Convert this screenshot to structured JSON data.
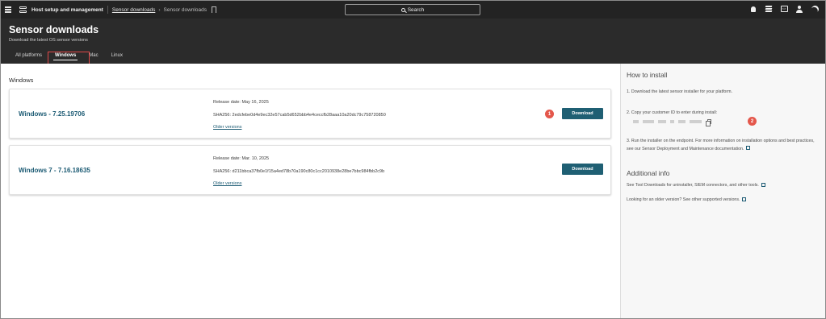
{
  "topbar": {
    "root": "Host setup and management",
    "crumb_link": "Sensor downloads",
    "crumb_current": "Sensor downloads",
    "chevron": "›",
    "search_label": "Search",
    "icons": [
      "bell-icon",
      "stack-icon",
      "keyboard-icon",
      "user-icon",
      "moon-icon"
    ]
  },
  "header": {
    "title": "Sensor downloads",
    "subtitle": "Download the latest OS sensor versions",
    "tabs": [
      "All platforms",
      "Windows",
      "Mac",
      "Linux"
    ],
    "active_tab": "Windows"
  },
  "main": {
    "section_title": "Windows",
    "sensors": [
      {
        "name": "Windows - 7.25.19706",
        "release": "Release date: May 16, 2025",
        "sha": "SHA256: 2edcfebe0d4e9ec32e57cab5d652bbb4e4ceccfb28aaa10a20dc79c758720850",
        "older": "Older versions",
        "download": "Download",
        "badge": "1"
      },
      {
        "name": "Windows 7 - 7.16.18635",
        "release": "Release date: Mar. 10, 2025",
        "sha": "SHA256: d211bbca37fb0e1f15a4ed78b70a190c80c1cc2010938e28be7bbc984fbb2c9b",
        "older": "Older versions",
        "download": "Download"
      }
    ]
  },
  "right_panel": {
    "how_title": "How to install",
    "step1": "1. Download the latest sensor installer for your platform.",
    "step2": "2. Copy your customer ID to enter during install:",
    "step3": "3. Run the installer on the endpoint. For more information on installation options and best practices, see our Sensor Deployment and Maintenance documentation.",
    "badge": "2",
    "info_title": "Additional info",
    "info1": "See Tool Downloads for uninstaller, SIEM connectors, and other tools.",
    "info2": "Looking for an older version? See other supported versions."
  },
  "colors": {
    "topbar": "#232323",
    "header": "#2b2b2b",
    "accent": "#1f5f73",
    "link": "#1b5a73",
    "badge": "#e4574b",
    "highlight": "#e04848"
  }
}
